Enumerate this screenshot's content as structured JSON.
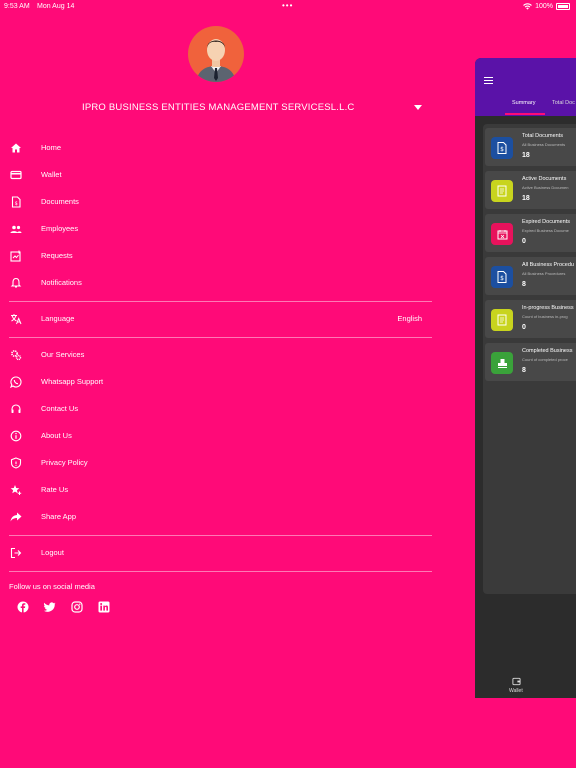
{
  "status_bar": {
    "time": "9:53 AM",
    "date": "Mon Aug 14",
    "battery": "100%"
  },
  "drawer": {
    "company_name": "IPRO BUSINESS ENTITIES MANAGEMENT SERVICESL.L.C",
    "menu": [
      {
        "label": "Home",
        "icon": "home-icon"
      },
      {
        "label": "Wallet",
        "icon": "wallet-icon"
      },
      {
        "label": "Documents",
        "icon": "document-icon"
      },
      {
        "label": "Employees",
        "icon": "people-icon"
      },
      {
        "label": "Requests",
        "icon": "request-icon"
      },
      {
        "label": "Notifications",
        "icon": "bell-icon"
      }
    ],
    "language": {
      "label": "Language",
      "value": "English"
    },
    "support": [
      {
        "label": "Our Services",
        "icon": "gears-icon"
      },
      {
        "label": "Whatsapp Support",
        "icon": "whatsapp-icon"
      },
      {
        "label": "Contact Us",
        "icon": "headset-icon"
      },
      {
        "label": "About Us",
        "icon": "info-icon"
      },
      {
        "label": "Privacy Policy",
        "icon": "shield-icon"
      },
      {
        "label": "Rate Us",
        "icon": "star-icon"
      },
      {
        "label": "Share App",
        "icon": "share-icon"
      }
    ],
    "logout": "Logout",
    "follow_text": "Follow us on social media"
  },
  "background_app": {
    "tabs": [
      "Summary",
      "Total Doc"
    ],
    "cards": [
      {
        "title": "Total Documents",
        "subtitle": "All Business Documents",
        "value": "18",
        "color": "#1c4fa0"
      },
      {
        "title": "Active Documents",
        "subtitle": "Active Business Documen",
        "value": "18",
        "color": "#c8d41e"
      },
      {
        "title": "Expired Documents",
        "subtitle": "Expired Business Docume",
        "value": "0",
        "color": "#e8125c"
      },
      {
        "title": "All Business Procedu",
        "subtitle": "All Business Procedures",
        "value": "8",
        "color": "#1c4fa0"
      },
      {
        "title": "In-progress Business",
        "subtitle": "Count of business in-prog",
        "value": "0",
        "color": "#c8d41e"
      },
      {
        "title": "Completed Business",
        "subtitle": "Count of completed proce",
        "value": "8",
        "color": "#3aa23a"
      }
    ],
    "bottom_label": "Wallet"
  },
  "colors": {
    "drawer_bg": "#ff0a78",
    "header_bg": "#5a12a8",
    "panel_bg": "#2c2c2c"
  }
}
